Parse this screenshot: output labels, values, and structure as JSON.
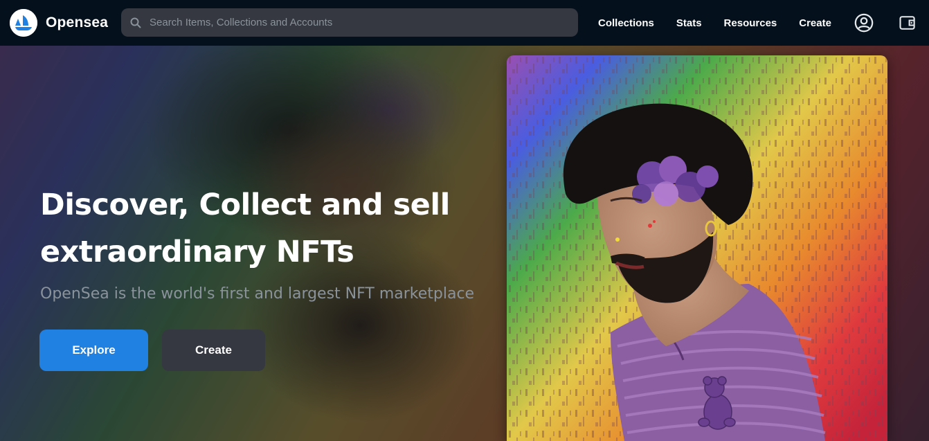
{
  "header": {
    "brand_name": "Opensea",
    "brand_logo_icon": "opensea-ship-logo",
    "search": {
      "placeholder": "Search Items, Collections and Accounts",
      "value": "",
      "icon": "search-icon"
    },
    "nav_items": [
      {
        "label": "Collections"
      },
      {
        "label": "Stats"
      },
      {
        "label": "Resources"
      },
      {
        "label": "Create"
      }
    ],
    "account_icon": "user-circle-icon",
    "wallet_icon": "wallet-icon"
  },
  "hero": {
    "title_line1": "Discover, Collect and sell",
    "title_line2": "extraordinary NFTs",
    "subtitle": "OpenSea is the world's first and largest NFT marketplace",
    "explore_label": "Explore",
    "create_label": "Create"
  },
  "colors": {
    "nav_background": "#04111d",
    "accent_blue": "#2081e2",
    "secondary_button": "#353840",
    "subtitle_gray": "#8a939b"
  }
}
